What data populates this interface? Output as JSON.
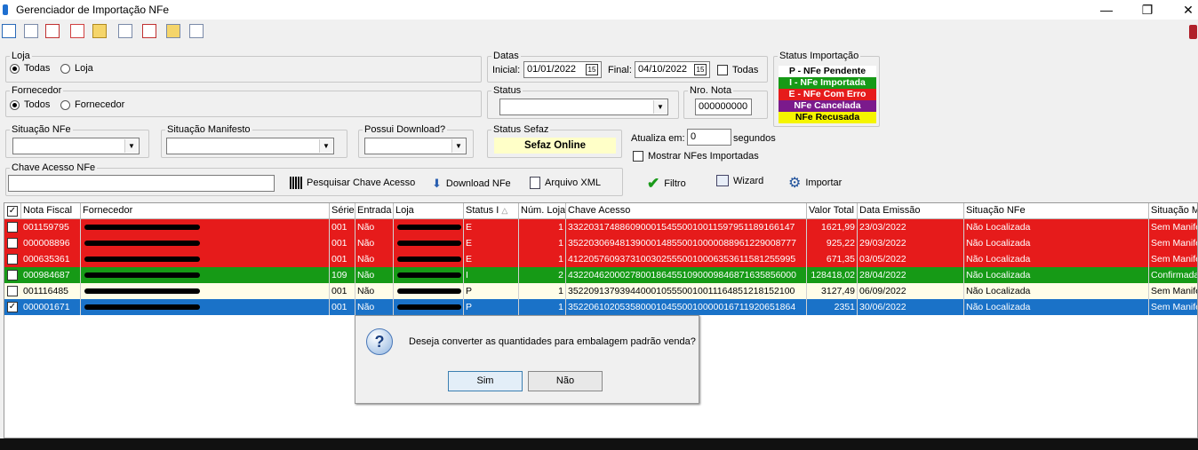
{
  "window": {
    "title": "Gerenciador de Importação NFe",
    "minimize": "—",
    "maximize": "❐",
    "close": "✕"
  },
  "loja": {
    "legend": "Loja",
    "opt_todas": "Todas",
    "opt_loja": "Loja"
  },
  "fornecedor": {
    "legend": "Fornecedor",
    "opt_todos": "Todos",
    "opt_fornecedor": "Fornecedor"
  },
  "datas": {
    "legend": "Datas",
    "inicial_label": "Inicial:",
    "inicial_value": "01/01/2022",
    "final_label": "Final:",
    "final_value": "04/10/2022",
    "todas_label": "Todas"
  },
  "status": {
    "legend": "Status",
    "value": ""
  },
  "nro_nota": {
    "legend": "Nro. Nota",
    "value": "000000000"
  },
  "status_importacao": {
    "legend": "Status Importação",
    "items": [
      {
        "text": "P - NFe Pendente",
        "bg": "#ffffff",
        "fg": "#000000"
      },
      {
        "text": "I - NFe Importada",
        "bg": "#169a16",
        "fg": "#ffffff"
      },
      {
        "text": "E - NFe Com Erro",
        "bg": "#e61b1b",
        "fg": "#ffffff"
      },
      {
        "text": "NFe Cancelada",
        "bg": "#7b1a8c",
        "fg": "#ffffff"
      },
      {
        "text": "NFe Recusada",
        "bg": "#f5f500",
        "fg": "#000000"
      }
    ]
  },
  "situacao_nfe": {
    "legend": "Situação NFe"
  },
  "situacao_manifesto": {
    "legend": "Situação Manifesto"
  },
  "possui_download": {
    "legend": "Possui Download?"
  },
  "status_sefaz": {
    "legend": "Status Sefaz",
    "value": "Sefaz Online"
  },
  "atualiza": {
    "label": "Atualiza em:",
    "value": "0",
    "unit": "segundos",
    "mostrar_label": "Mostrar NFes Importadas"
  },
  "chave": {
    "legend": "Chave Acesso NFe",
    "value": "",
    "pesquisar": "Pesquisar Chave Acesso",
    "download": "Download NFe",
    "arquivo": "Arquivo XML"
  },
  "actions": {
    "filtro": "Filtro",
    "wizard": "Wizard",
    "importar": "Importar"
  },
  "grid": {
    "headers": [
      "Nota Fiscal",
      "Fornecedor",
      "Série",
      "Entrada",
      "Loja",
      "Status I",
      "Núm. Loja",
      "Chave Acesso",
      "Valor Total",
      "Data Emissão",
      "Situação NFe",
      "Situação M"
    ],
    "rows": [
      {
        "checked": false,
        "color": "red",
        "nota": "001159795",
        "serie": "001",
        "entrada": "Não",
        "status": "E",
        "numloja": "1",
        "chave": "33220317488609000154550010011597951189166147",
        "valor": "1621,99",
        "data": "23/03/2022",
        "situacao": "Não Localizada",
        "manifesto": "Sem Manife"
      },
      {
        "checked": false,
        "color": "red",
        "nota": "000008896",
        "serie": "001",
        "entrada": "Não",
        "status": "E",
        "numloja": "1",
        "chave": "35220306948139000148550010000088961229008777",
        "valor": "925,22",
        "data": "29/03/2022",
        "situacao": "Não Localizada",
        "manifesto": "Sem Manife"
      },
      {
        "checked": false,
        "color": "red",
        "nota": "000635361",
        "serie": "001",
        "entrada": "Não",
        "status": "E",
        "numloja": "1",
        "chave": "41220576093731003025550010006353611581255995",
        "valor": "671,35",
        "data": "03/05/2022",
        "situacao": "Não Localizada",
        "manifesto": "Sem Manife"
      },
      {
        "checked": false,
        "color": "green",
        "nota": "000984687",
        "serie": "109",
        "entrada": "Não",
        "status": "I",
        "numloja": "2",
        "chave": "43220462000278001864551090009846871635856000",
        "valor": "128418,02",
        "data": "28/04/2022",
        "situacao": "Não Localizada",
        "manifesto": "Confirmada"
      },
      {
        "checked": false,
        "color": "cream",
        "nota": "001116485",
        "serie": "001",
        "entrada": "Não",
        "status": "P",
        "numloja": "1",
        "chave": "35220913793944000105550010011164851218152100",
        "valor": "3127,49",
        "data": "06/09/2022",
        "situacao": "Não Localizada",
        "manifesto": "Sem Manife"
      },
      {
        "checked": true,
        "color": "blue",
        "nota": "000001671",
        "serie": "001",
        "entrada": "Não",
        "status": "P",
        "numloja": "1",
        "chave": "35220610205358000104550010000016711920651864",
        "valor": "2351",
        "data": "30/06/2022",
        "situacao": "Não Localizada",
        "manifesto": "Sem Manife"
      }
    ]
  },
  "dialog": {
    "message": "Deseja converter as quantidades para embalagem padrão venda?",
    "yes": "Sim",
    "no": "Não"
  }
}
